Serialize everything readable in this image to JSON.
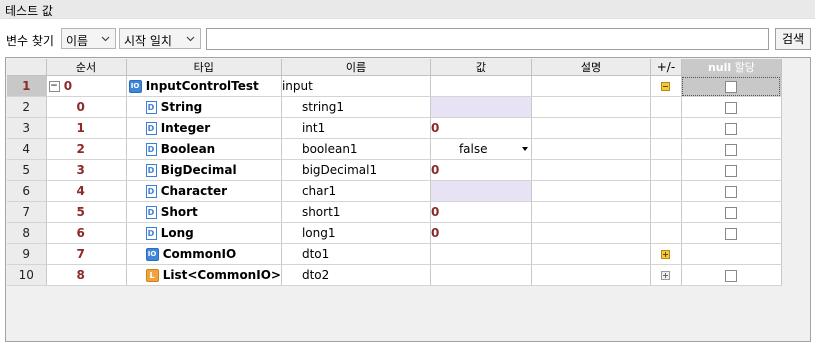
{
  "window": {
    "title": "테스트 값"
  },
  "search": {
    "var_label": "변수 찾기",
    "field_select": "이름",
    "match_select": "시작 일치",
    "input_value": "",
    "button_label": "검색"
  },
  "grid": {
    "headers": {
      "order": "순서",
      "type": "타입",
      "name": "이름",
      "value": "값",
      "description": "설명",
      "plusminus": "+/-",
      "null_assign_a": "null",
      "null_assign_b": " 할당"
    },
    "rows": [
      {
        "row": "1",
        "order": "0",
        "type": "InputControlTest",
        "name": "input",
        "value": "",
        "icon": "class-icon"
      },
      {
        "row": "2",
        "order": "0",
        "type": "String",
        "name": "string1",
        "value": "",
        "icon": "field-icon"
      },
      {
        "row": "3",
        "order": "1",
        "type": "Integer",
        "name": "int1",
        "value": "0",
        "icon": "field-icon"
      },
      {
        "row": "4",
        "order": "2",
        "type": "Boolean",
        "name": "boolean1",
        "value": "false",
        "icon": "field-icon"
      },
      {
        "row": "5",
        "order": "3",
        "type": "BigDecimal",
        "name": "bigDecimal1",
        "value": "0",
        "icon": "field-icon"
      },
      {
        "row": "6",
        "order": "4",
        "type": "Character",
        "name": "char1",
        "value": "",
        "icon": "field-icon"
      },
      {
        "row": "7",
        "order": "5",
        "type": "Short",
        "name": "short1",
        "value": "0",
        "icon": "field-icon"
      },
      {
        "row": "8",
        "order": "6",
        "type": "Long",
        "name": "long1",
        "value": "0",
        "icon": "field-icon"
      },
      {
        "row": "9",
        "order": "7",
        "type": "CommonIO",
        "name": "dto1",
        "value": "",
        "icon": "class-icon"
      },
      {
        "row": "10",
        "order": "8",
        "type": "List<CommonIO>",
        "name": "dto2",
        "value": "",
        "icon": "list-icon"
      }
    ]
  },
  "icons": {
    "class_icon_text": "IO",
    "field_icon_text": "D",
    "list_icon_text": "L"
  },
  "colors": {
    "order_text": "#8b2a2a",
    "value_cell_bg": "#e7e3f5",
    "selected_row_bg": "#c8c8c8"
  }
}
